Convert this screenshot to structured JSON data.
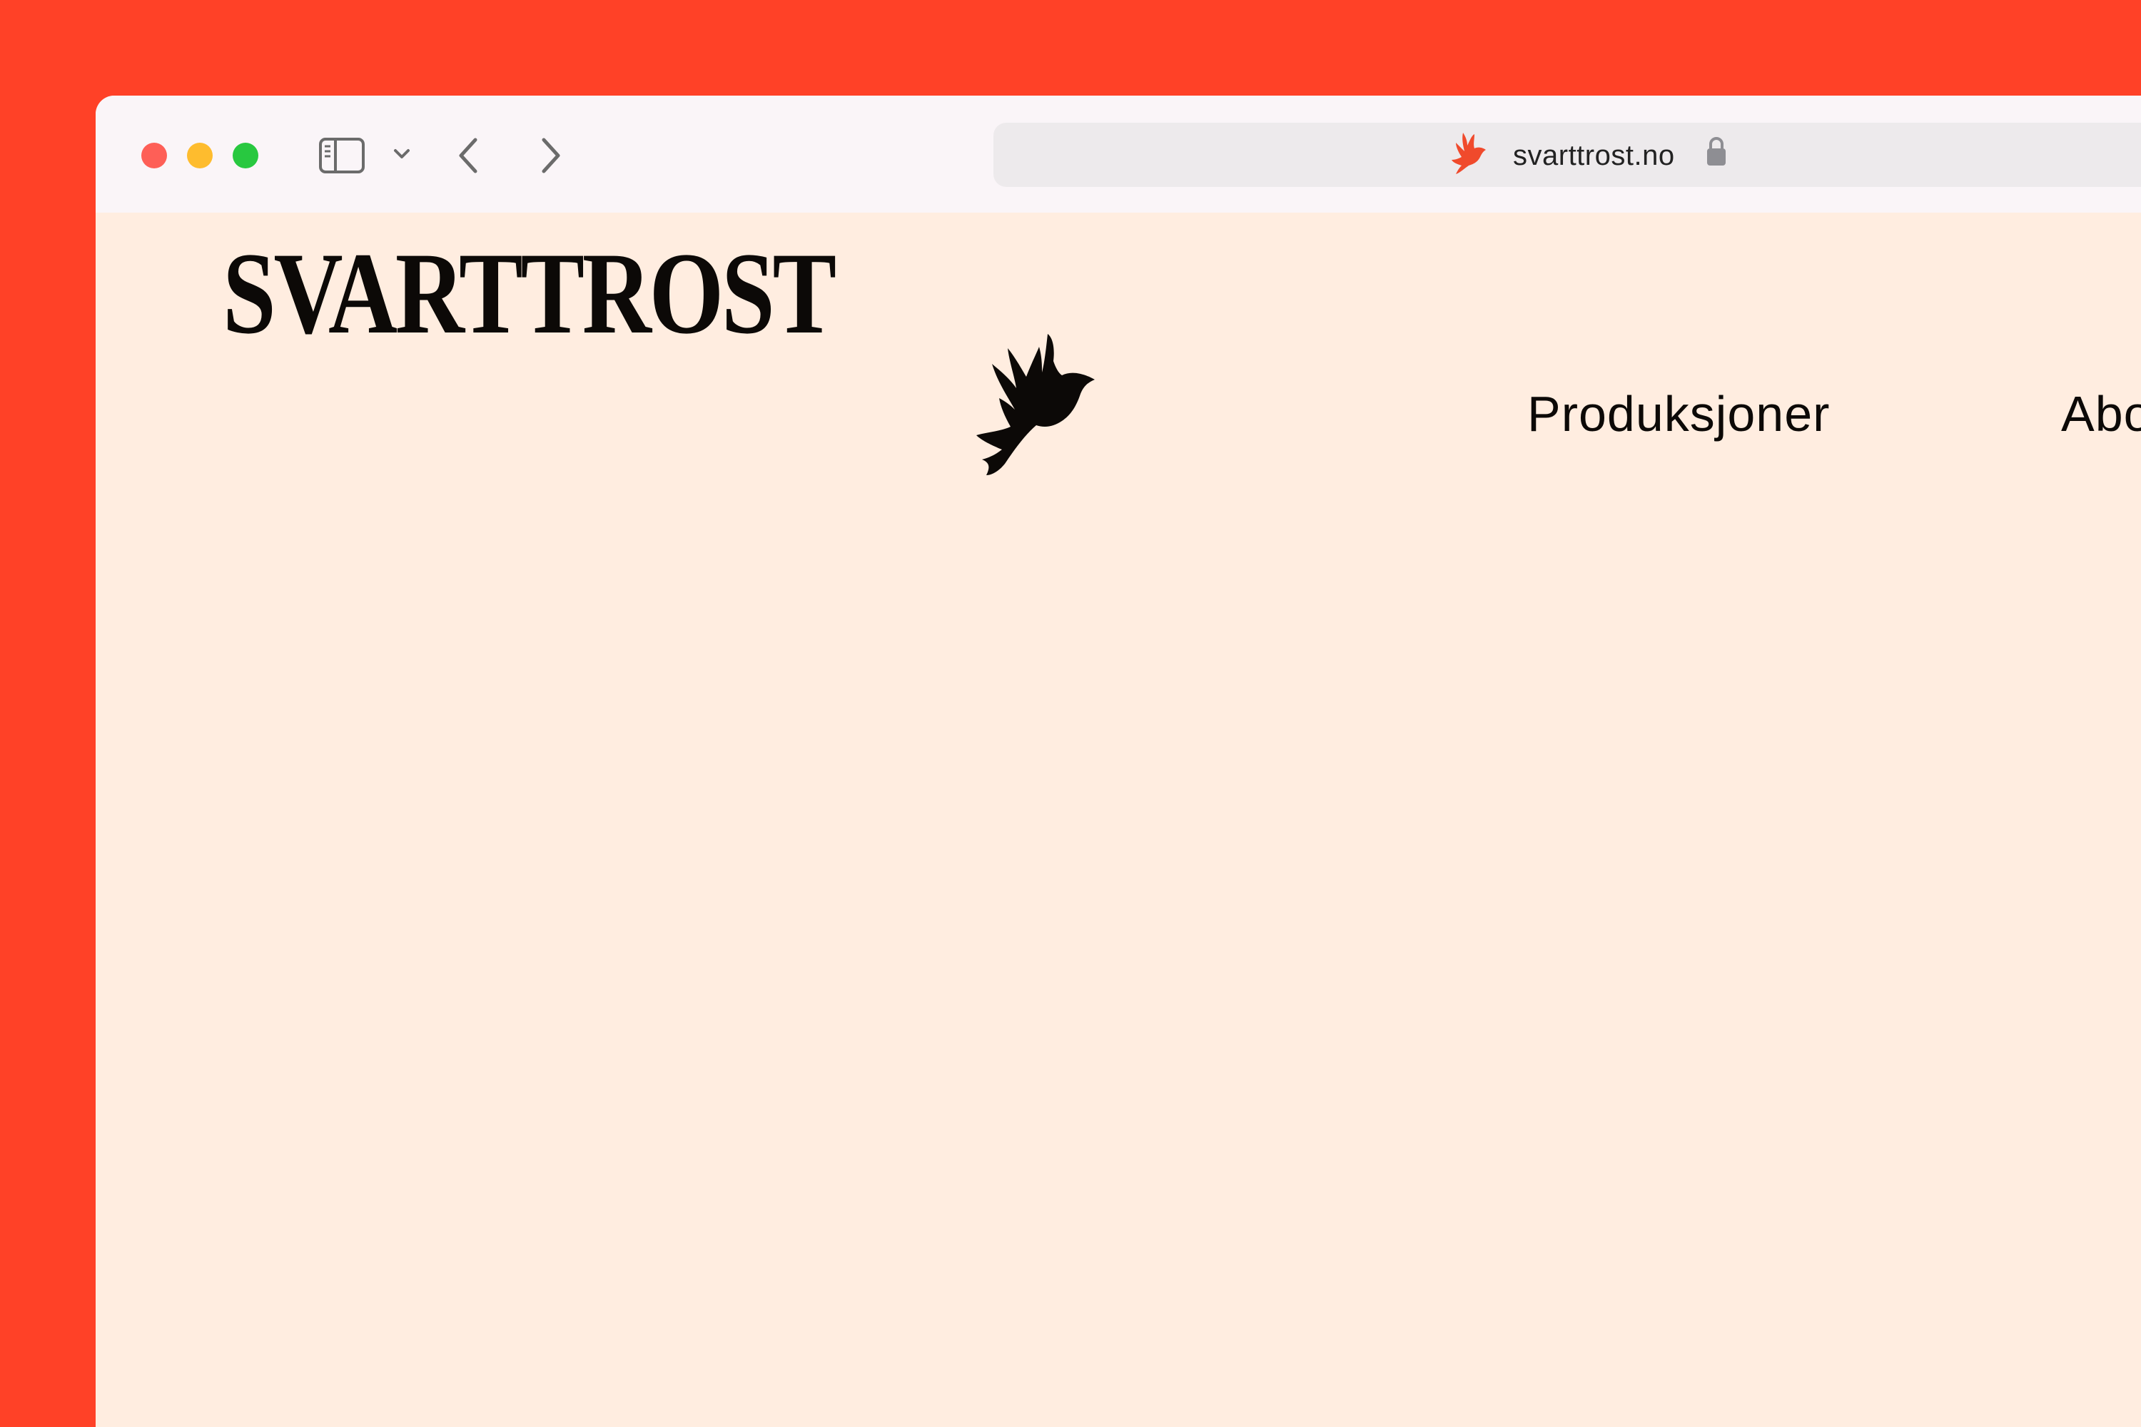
{
  "browser": {
    "address_bar": {
      "url": "svarttrost.no",
      "favicon": "bird-icon",
      "secure": true
    },
    "toolbar": {
      "icons": [
        "sidebar-icon",
        "chevron-down-icon",
        "back-arrow-icon",
        "forward-arrow-icon"
      ]
    }
  },
  "site": {
    "logo_text": "SVARTTROST",
    "nav": [
      {
        "label": "Produksjoner"
      },
      {
        "label": "Abo"
      }
    ]
  },
  "colors": {
    "backdrop": "#ff4127",
    "page_background": "#ffede0",
    "toolbar_background": "#faf5f8",
    "address_bar_background": "#edeaec",
    "text": "#0c0907",
    "favicon_accent": "#f04a2c"
  }
}
